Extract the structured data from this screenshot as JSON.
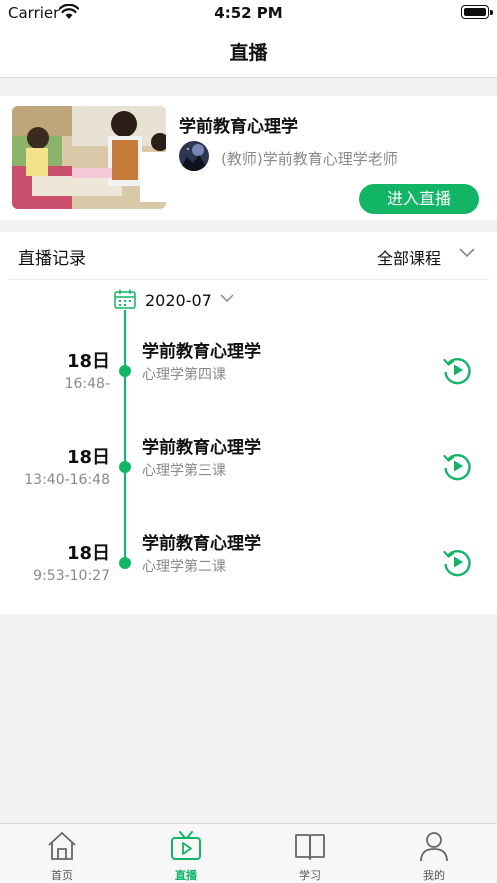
{
  "status_bar": {
    "carrier": "Carrier",
    "time": "4:52 PM"
  },
  "nav": {
    "title": "直播"
  },
  "live": {
    "course_title": "学前教育心理学",
    "teacher": "(教师)学前教育心理学老师",
    "enter_label": "进入直播"
  },
  "records": {
    "title": "直播记录",
    "filter_label": "全部课程",
    "month": "2020-07",
    "items": [
      {
        "day": "18日",
        "time": "16:48-",
        "title": "学前教育心理学",
        "subtitle": "心理学第四课"
      },
      {
        "day": "18日",
        "time": "13:40-16:48",
        "title": "学前教育心理学",
        "subtitle": "心理学第三课"
      },
      {
        "day": "18日",
        "time": "9:53-10:27",
        "title": "学前教育心理学",
        "subtitle": "心理学第二课"
      }
    ]
  },
  "tabs": [
    {
      "label": "首页",
      "icon": "home-icon"
    },
    {
      "label": "直播",
      "icon": "tv-icon",
      "active": true
    },
    {
      "label": "学习",
      "icon": "book-icon"
    },
    {
      "label": "我的",
      "icon": "person-icon"
    }
  ],
  "colors": {
    "accent": "#12b466"
  }
}
